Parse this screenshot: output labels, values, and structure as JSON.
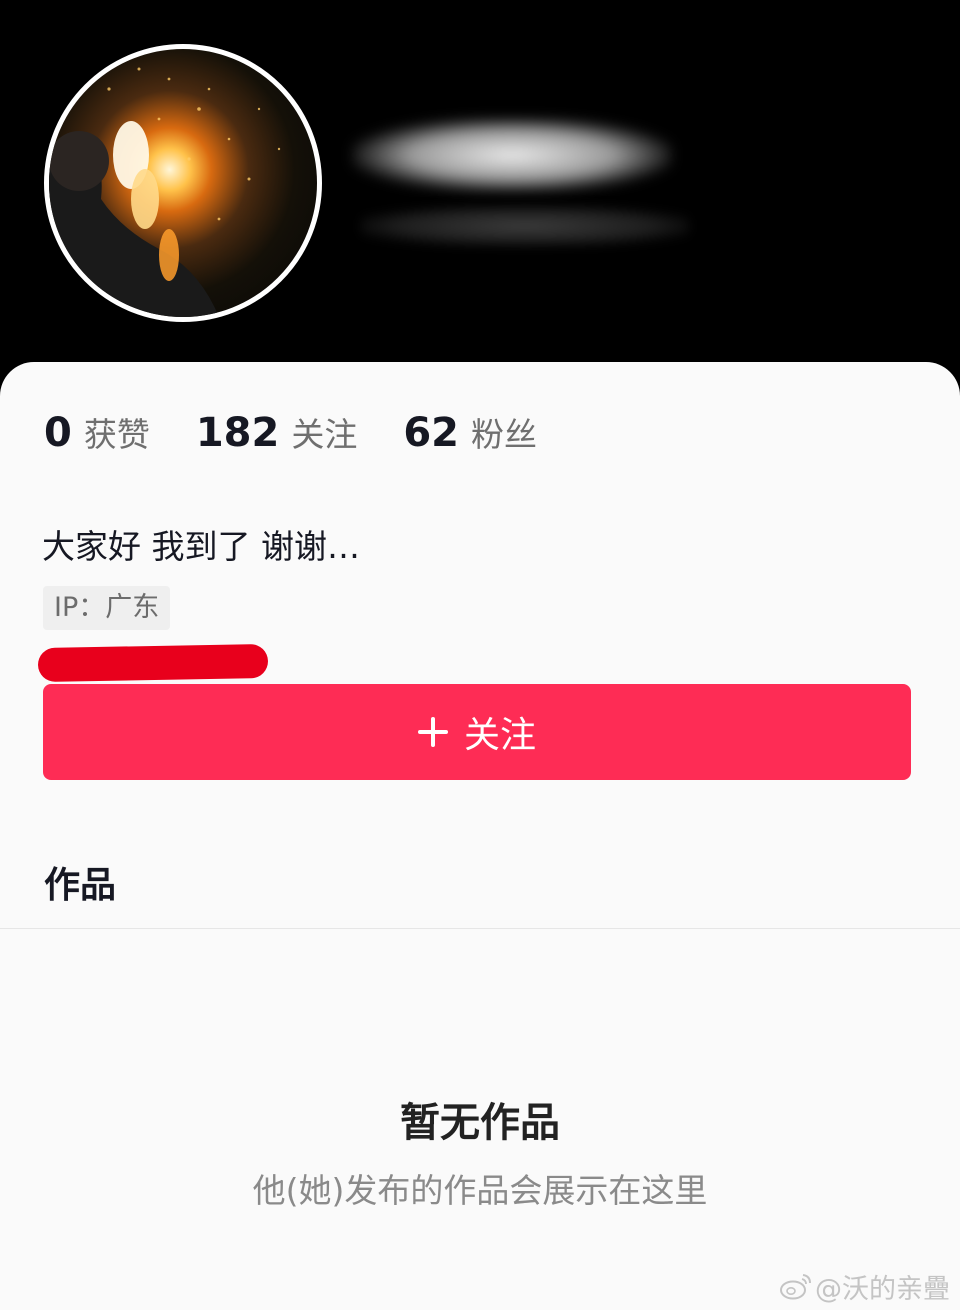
{
  "profile": {
    "stats": [
      {
        "value": "0",
        "label": "获赞"
      },
      {
        "value": "182",
        "label": "关注"
      },
      {
        "value": "62",
        "label": "粉丝"
      }
    ],
    "bio": "大家好 我到了 谢谢…",
    "ip_label": "IP：广东"
  },
  "follow_button": {
    "label": "关注",
    "icon": "plus-icon"
  },
  "works": {
    "tab_title": "作品",
    "empty_title": "暂无作品",
    "empty_desc": "他(她)发布的作品会展示在这里"
  },
  "watermark": {
    "text": "@沃的亲疊",
    "icon": "weibo-icon"
  },
  "colors": {
    "accent": "#fe2c55",
    "header_bg": "#000000",
    "card_bg": "#fafafa",
    "annotation_mark": "#e8001c"
  }
}
